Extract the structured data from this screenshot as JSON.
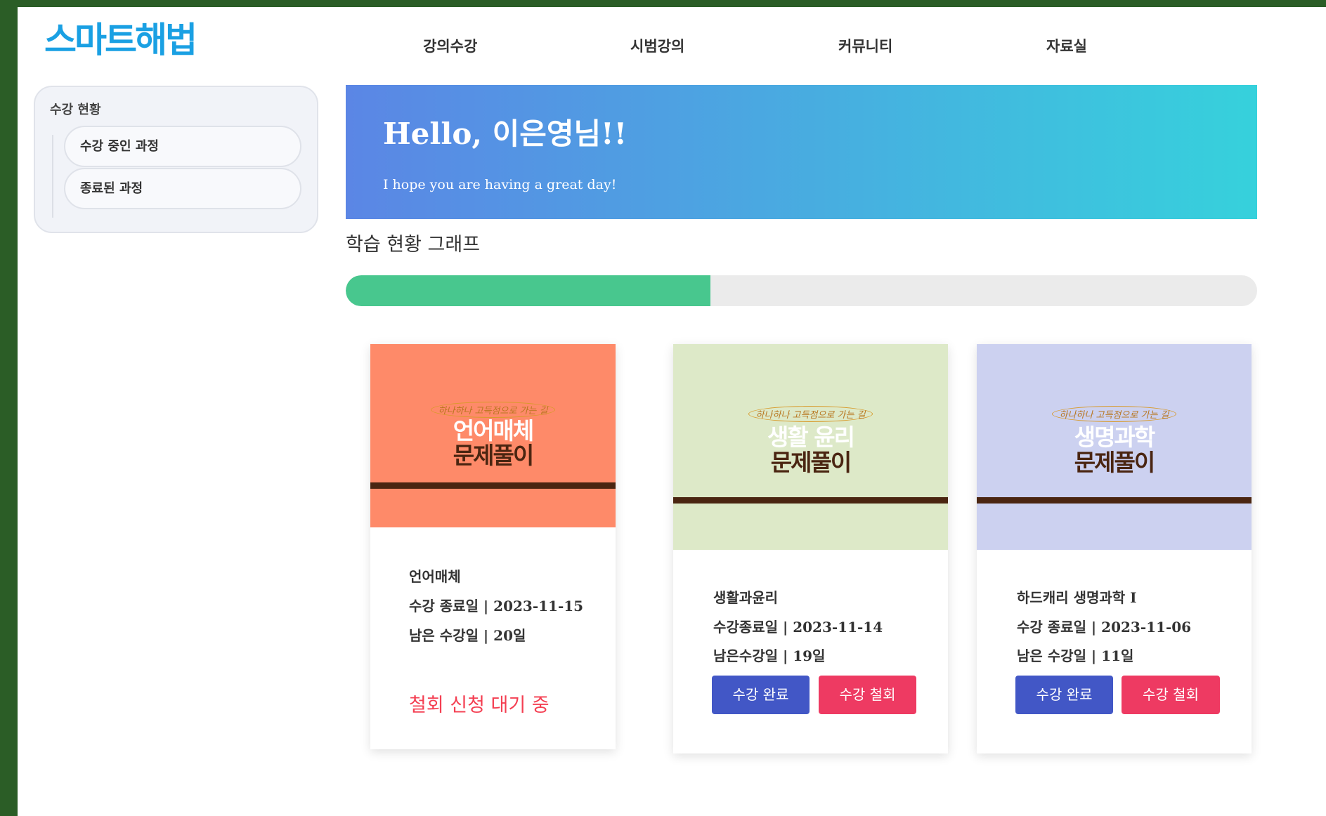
{
  "header": {
    "logo": "스마트해법",
    "nav": [
      "강의수강",
      "시범강의",
      "커뮤니티",
      "자료실"
    ]
  },
  "sidebar": {
    "title": "수강 현황",
    "items": [
      "수강 중인 과정",
      "종료된 과정"
    ]
  },
  "banner": {
    "title": "Hello, 이은영님!!",
    "subtitle": "I hope you are having a great day!",
    "gradient": [
      "#5b86e5",
      "#36d1dc"
    ]
  },
  "graph": {
    "title": "학습 현황 그래프",
    "progress_percent": 40,
    "fill_color": "#48c78e"
  },
  "courses": [
    {
      "thumb_script": "하나하나 고득점으로 가는 길",
      "thumb_title_1": "언어매체",
      "thumb_title_2": "문제풀이",
      "thumb_bg": "#fe8a69",
      "title_color_1": "#ffffff",
      "name": "언어매체",
      "end_date": "수강 종료일 | 2023-11-15",
      "days_left": "남은 수강일 | 20일",
      "status": "철회 신청 대기 중"
    },
    {
      "thumb_script": "하나하나 고득점으로 가는 길",
      "thumb_title_1": "생활 윤리",
      "thumb_title_2": "문제풀이",
      "thumb_bg": "#dde9c8",
      "title_color_1": "#ffffff",
      "name": "생활과윤리",
      "end_date": "수강종료일 | 2023-11-14",
      "days_left": "남은수강일 | 19일",
      "complete_label": "수강 완료",
      "withdraw_label": "수강 철회"
    },
    {
      "thumb_script": "하나하나 고득점으로 가는 길",
      "thumb_title_1": "생명과학",
      "thumb_title_2": "문제풀이",
      "thumb_bg": "#ccd1f0",
      "title_color_1": "#ffffff",
      "name": "하드캐리 생명과학 I",
      "end_date": "수강 종료일 | 2023-11-06",
      "days_left": "남은 수강일 | 11일",
      "complete_label": "수강 완료",
      "withdraw_label": "수강 철회"
    }
  ]
}
